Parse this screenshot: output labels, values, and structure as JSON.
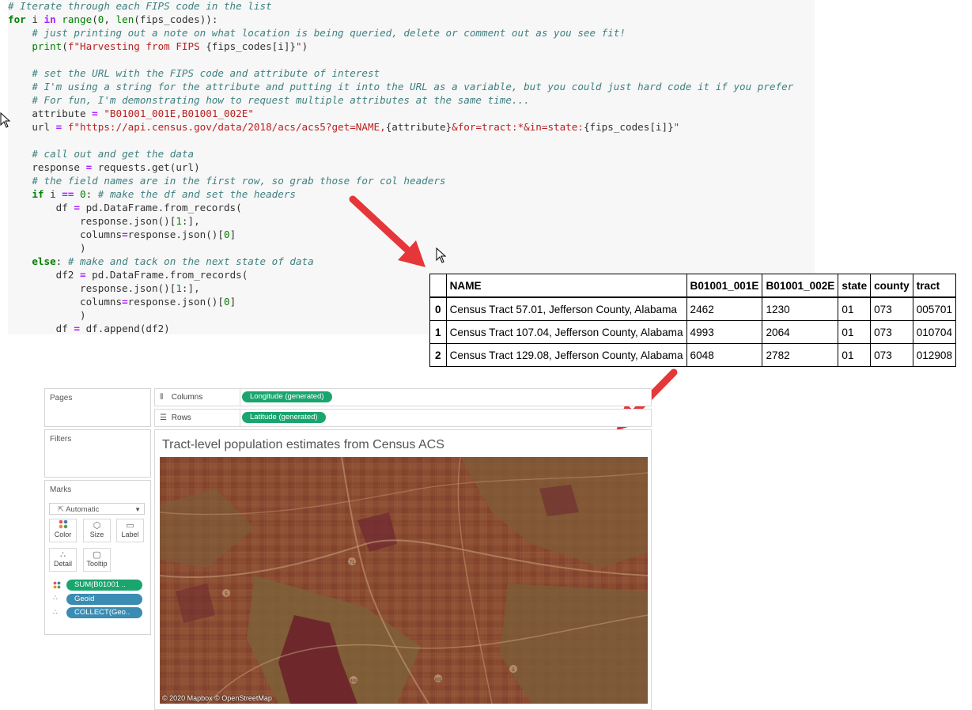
{
  "code": {
    "lines": [
      [
        [
          "c-cm",
          "# Iterate through each FIPS code in the list"
        ]
      ],
      [
        [
          "c-kw",
          "for"
        ],
        [
          "c-n",
          " i "
        ],
        [
          "c-op",
          "in"
        ],
        [
          "c-n",
          " "
        ],
        [
          "c-bi",
          "range"
        ],
        [
          "c-n",
          "("
        ],
        [
          "c-nm",
          "0"
        ],
        [
          "c-n",
          ", "
        ],
        [
          "c-bi",
          "len"
        ],
        [
          "c-n",
          "(fips_codes)):"
        ]
      ],
      [
        [
          "c-n",
          "    "
        ],
        [
          "c-cm",
          "# just printing out a note on what location is being queried, delete or comment out as you see fit!"
        ]
      ],
      [
        [
          "c-n",
          "    "
        ],
        [
          "c-bi",
          "print"
        ],
        [
          "c-n",
          "("
        ],
        [
          "c-st",
          "f\"Harvesting from FIPS "
        ],
        [
          "c-n",
          "{fips_codes[i]}"
        ],
        [
          "c-st",
          "\""
        ],
        [
          "c-n",
          ")"
        ]
      ],
      [
        [
          "c-n",
          " "
        ]
      ],
      [
        [
          "c-n",
          "    "
        ],
        [
          "c-cm",
          "# set the URL with the FIPS code and attribute of interest"
        ]
      ],
      [
        [
          "c-n",
          "    "
        ],
        [
          "c-cm",
          "# I'm using a string for the attribute and putting it into the URL as a variable, but you could just hard code it if you prefer"
        ]
      ],
      [
        [
          "c-n",
          "    "
        ],
        [
          "c-cm",
          "# For fun, I'm demonstrating how to request multiple attributes at the same time..."
        ]
      ],
      [
        [
          "c-n",
          "    attribute "
        ],
        [
          "c-op",
          "="
        ],
        [
          "c-n",
          " "
        ],
        [
          "c-st",
          "\"B01001_001E,B01001_002E\""
        ]
      ],
      [
        [
          "c-n",
          "    url "
        ],
        [
          "c-op",
          "="
        ],
        [
          "c-n",
          " "
        ],
        [
          "c-st",
          "f\"https://api.census.gov/data/2018/acs/acs5?get=NAME,"
        ],
        [
          "c-n",
          "{attribute}"
        ],
        [
          "c-st",
          "&for=tract:*&in=state:"
        ],
        [
          "c-n",
          "{fips_codes[i]}"
        ],
        [
          "c-st",
          "\""
        ]
      ],
      [
        [
          "c-n",
          " "
        ]
      ],
      [
        [
          "c-n",
          "    "
        ],
        [
          "c-cm",
          "# call out and get the data"
        ]
      ],
      [
        [
          "c-n",
          "    response "
        ],
        [
          "c-op",
          "="
        ],
        [
          "c-n",
          " requests.get(url)"
        ]
      ],
      [
        [
          "c-n",
          "    "
        ],
        [
          "c-cm",
          "# the field names are in the first row, so grab those for col headers"
        ]
      ],
      [
        [
          "c-n",
          "    "
        ],
        [
          "c-kw",
          "if"
        ],
        [
          "c-n",
          " i "
        ],
        [
          "c-op",
          "=="
        ],
        [
          "c-n",
          " "
        ],
        [
          "c-nm",
          "0"
        ],
        [
          "c-n",
          ": "
        ],
        [
          "c-cm",
          "# make the df and set the headers"
        ]
      ],
      [
        [
          "c-n",
          "        df "
        ],
        [
          "c-op",
          "="
        ],
        [
          "c-n",
          " pd.DataFrame.from_records("
        ]
      ],
      [
        [
          "c-n",
          "            response.json()["
        ],
        [
          "c-nm",
          "1"
        ],
        [
          "c-n",
          ":],"
        ]
      ],
      [
        [
          "c-n",
          "            columns"
        ],
        [
          "c-op",
          "="
        ],
        [
          "c-n",
          "response.json()["
        ],
        [
          "c-nm",
          "0"
        ],
        [
          "c-n",
          "]"
        ]
      ],
      [
        [
          "c-n",
          "            )"
        ]
      ],
      [
        [
          "c-kw",
          "    else"
        ],
        [
          "c-n",
          ": "
        ],
        [
          "c-cm",
          "# make and tack on the next state of data"
        ]
      ],
      [
        [
          "c-n",
          "        df2 "
        ],
        [
          "c-op",
          "="
        ],
        [
          "c-n",
          " pd.DataFrame.from_records("
        ]
      ],
      [
        [
          "c-n",
          "            response.json()["
        ],
        [
          "c-nm",
          "1"
        ],
        [
          "c-n",
          ":],"
        ]
      ],
      [
        [
          "c-n",
          "            columns"
        ],
        [
          "c-op",
          "="
        ],
        [
          "c-n",
          "response.json()["
        ],
        [
          "c-nm",
          "0"
        ],
        [
          "c-n",
          "]"
        ]
      ],
      [
        [
          "c-n",
          "            )"
        ]
      ],
      [
        [
          "c-n",
          "        df "
        ],
        [
          "c-op",
          "="
        ],
        [
          "c-n",
          " df.append(df2)"
        ]
      ]
    ]
  },
  "table": {
    "columns": [
      "",
      "NAME",
      "B01001_001E",
      "B01001_002E",
      "state",
      "county",
      "tract"
    ],
    "rows": [
      [
        "0",
        "Census Tract 57.01, Jefferson County, Alabama",
        "2462",
        "1230",
        "01",
        "073",
        "005701"
      ],
      [
        "1",
        "Census Tract 107.04, Jefferson County, Alabama",
        "4993",
        "2064",
        "01",
        "073",
        "010704"
      ],
      [
        "2",
        "Census Tract 129.08, Jefferson County, Alabama",
        "6048",
        "2782",
        "01",
        "073",
        "012908"
      ]
    ]
  },
  "tableau": {
    "pages_label": "Pages",
    "filters_label": "Filters",
    "marks_label": "Marks",
    "mark_type": "Automatic",
    "mark_buttons": {
      "color": "Color",
      "size": "Size",
      "label": "Label",
      "detail": "Detail",
      "tooltip": "Tooltip"
    },
    "mark_pills": {
      "color_field": "SUM(B01001 ..",
      "geoid": "Geoid",
      "collect": "COLLECT(Geo.."
    },
    "columns_label": "Columns",
    "rows_label": "Rows",
    "columns_pill": "Longitude (generated)",
    "rows_pill": "Latitude (generated)",
    "viz_title": "Tract-level population estimates from Census ACS",
    "map_credit": "© 2020 Mapbox © OpenStreetMap",
    "map_labels": [
      "71",
      "5",
      "5",
      "605",
      "405"
    ],
    "colors": {
      "pill_green": "#1aa56e",
      "pill_blue": "#3a8cb3",
      "arrow": "#e5363a"
    }
  }
}
